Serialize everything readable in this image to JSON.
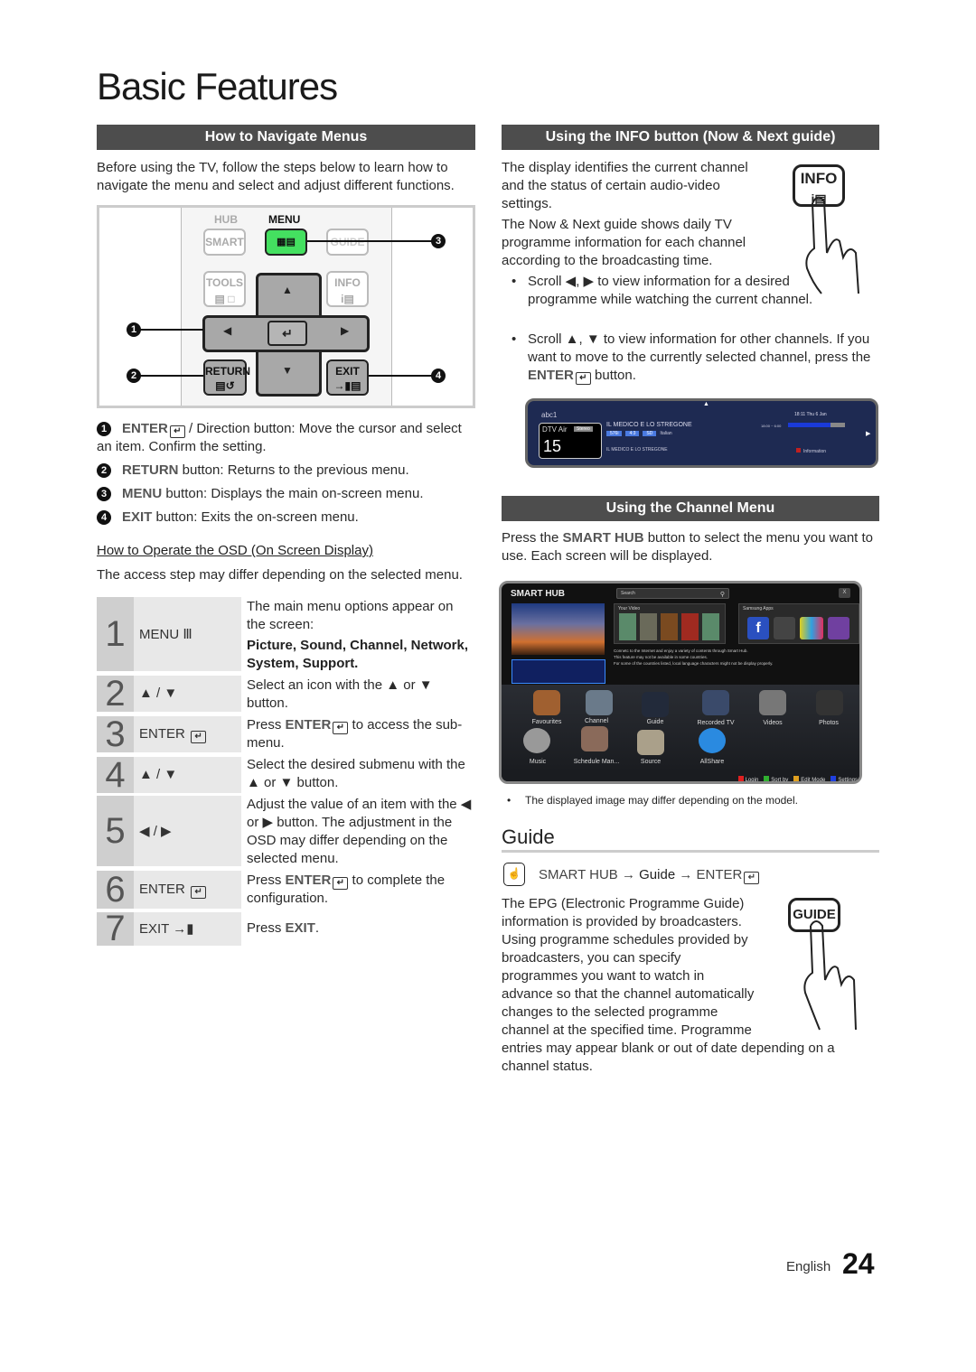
{
  "page": {
    "title": "Basic Features",
    "language": "English",
    "page_number": "24"
  },
  "navigate": {
    "header": "How to Navigate Menus",
    "intro": "Before using the TV, follow the steps below to learn how to navigate the menu and select and adjust different functions.",
    "remote": {
      "hub_label": "HUB",
      "smart": "SMART",
      "menu_label": "MENU",
      "guide": "GUIDE",
      "tools": "TOOLS",
      "info": "INFO",
      "return": "RETURN",
      "exit": "EXIT",
      "callouts": [
        "1",
        "2",
        "3",
        "4"
      ]
    },
    "legend": [
      {
        "num": "1",
        "key": "ENTER",
        "text": " / Direction button: Move the cursor and select an item. Confirm the setting."
      },
      {
        "num": "2",
        "key": "RETURN",
        "text": " button: Returns to the previous menu."
      },
      {
        "num": "3",
        "key": "MENU",
        "text": " button: Displays the main on-screen menu."
      },
      {
        "num": "4",
        "key": "EXIT",
        "text": " button: Exits the on-screen menu."
      }
    ],
    "osd_title": "How to Operate the OSD (On Screen Display)",
    "osd_note": "The access step may differ depending on the selected menu.",
    "steps": [
      {
        "num": "1",
        "key": "MENU Ⅲ",
        "desc": "The main menu options appear on the screen:",
        "desc_bold": "Picture, Sound, Channel, Network, System, Support."
      },
      {
        "num": "2",
        "key": "▲ / ▼",
        "desc": "Select an icon with the ▲ or ▼ button."
      },
      {
        "num": "3",
        "key": "ENTER",
        "desc_pre": "Press ",
        "desc_key": "ENTER",
        "desc": " to access the sub-menu."
      },
      {
        "num": "4",
        "key": "▲ / ▼",
        "desc": "Select the desired submenu with the ▲ or ▼ button."
      },
      {
        "num": "5",
        "key": "◀ / ▶",
        "desc": "Adjust the value of an item with the ◀ or ▶ button. The adjustment in the OSD may differ depending on the selected menu."
      },
      {
        "num": "6",
        "key": "ENTER",
        "desc_pre": "Press ",
        "desc_key": "ENTER",
        "desc": " to complete the configuration."
      },
      {
        "num": "7",
        "key": "EXIT →▮",
        "desc_pre": "Press ",
        "desc_key": "EXIT",
        "desc": "."
      }
    ]
  },
  "info": {
    "header": "Using the INFO button (Now & Next guide)",
    "p1": "The display identifies the current channel and the status of certain audio-video settings.",
    "p2": "The Now & Next guide shows daily TV programme information for each channel according to the broadcasting time.",
    "bullet1": "Scroll ◀, ▶ to view information for a desired programme while watching the current channel.",
    "bullet2_a": "Scroll ▲, ▼ to view information for other channels. If you want to move to the currently selected channel, press the ",
    "bullet2_key": "ENTER",
    "bullet2_b": " button.",
    "button_label": "INFO",
    "epg": {
      "channel_name": "abc1",
      "source": "DTV Air",
      "audio": "Stereo",
      "channel_number": "15",
      "programme": "IL MEDICO E LO STREGONE",
      "tags": [
        "576i",
        "4:3",
        "SD"
      ],
      "language": "Italian",
      "next_programme": "IL MEDICO E LO STREGONE",
      "datetime": "18:11 Thu 6 Jan",
      "time_range": "18:00 ~ 6:00",
      "progress": 0.75,
      "info_hint": "Information"
    }
  },
  "channel_menu": {
    "header": "Using the Channel Menu",
    "intro_pre": "Press the ",
    "intro_key": "SMART HUB",
    "intro_post": " button to select the menu you want to use. Each screen will be displayed.",
    "note": "The displayed image may differ depending on the model.",
    "hub": {
      "logo": "SMART HUB",
      "search_placeholder": "Search",
      "close": "X",
      "your_video": "Your Video",
      "samsung_apps": "Samsung Apps",
      "msg1": "Connetc to the Internet and enjoy a variety of contents through Smart Hub.",
      "msg2": "This feature may not be available in some countries.",
      "msg3": "For some of the countries listed, local language characters might not be display properly.",
      "apps_row1": [
        "Favourites",
        "Channel",
        "Guide",
        "Recorded TV",
        "Videos",
        "Photos"
      ],
      "apps_row2": [
        "Music",
        "Schedule Man...",
        "Source",
        "AllShare"
      ],
      "footer": [
        {
          "key": "A",
          "label": "Login",
          "color": "#e02020"
        },
        {
          "key": "B",
          "label": "Sort by",
          "color": "#30b030"
        },
        {
          "key": "C",
          "label": "Edit Mode",
          "color": "#e0a020"
        },
        {
          "key": "D",
          "label": "Settings",
          "color": "#2040e0"
        }
      ]
    }
  },
  "guide": {
    "title": "Guide",
    "path_a": "SMART HUB → ",
    "path_b": "Guide",
    "path_c": " → ENTER",
    "button_label": "GUIDE",
    "text": "The EPG (Electronic Programme Guide) information is provided by broadcasters. Using programme schedules provided by broadcasters, you can specify programmes you want to watch in advance so that the channel automatically changes to the selected programme channel at the specified time. Programme entries may appear blank or out of date depending on a channel status."
  }
}
